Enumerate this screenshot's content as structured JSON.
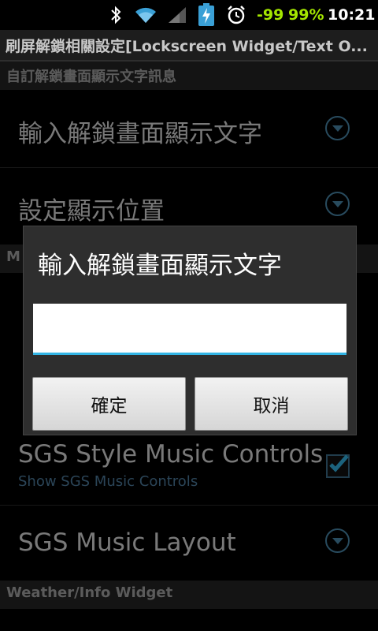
{
  "status_bar": {
    "battery_level_text": "-99",
    "battery_percent": "99%",
    "time": "10:21",
    "icons": [
      "bluetooth-icon",
      "wifi-icon",
      "signal-icon",
      "battery-charging-icon",
      "alarm-icon"
    ]
  },
  "title_bar": {
    "title": "刷屏解鎖相關設定[Lockscreen Widget/Text O..."
  },
  "sections": [
    {
      "header": "自訂解鎖畫面顯示文字訊息"
    },
    {
      "header": "Weather/Info Widget"
    }
  ],
  "preferences": [
    {
      "title": "輸入解鎖畫面顯示文字"
    },
    {
      "title": "設定顯示位置"
    },
    {
      "title": "SGS Style Music Controls",
      "summary": "Show SGS Music Controls",
      "checked": true
    },
    {
      "title": "SGS Music Layout"
    }
  ],
  "hidden_fragments": {
    "cat_prefix": "M"
  },
  "dialog": {
    "title": "輸入解鎖畫面顯示文字",
    "input_value": "",
    "ok_label": "確定",
    "cancel_label": "取消"
  },
  "colors": {
    "accent": "#33b5e5",
    "battery_green": "#a4e600",
    "link_blue": "#4a89ac"
  }
}
